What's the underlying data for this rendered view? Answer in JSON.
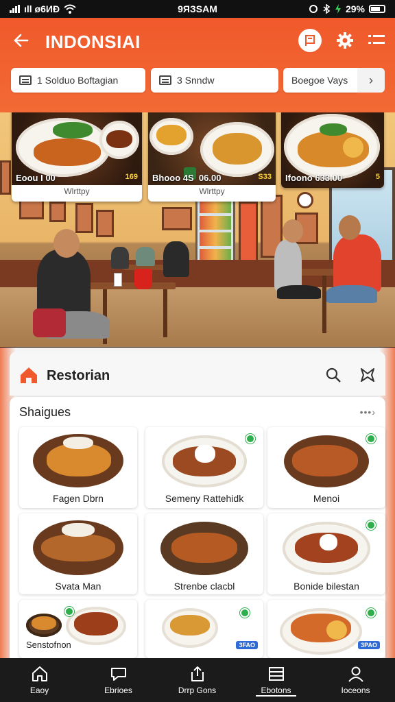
{
  "status_bar": {
    "carrier": "ıll ø6ИÐ",
    "time": "9ЯЗSAM",
    "battery": "29%"
  },
  "header": {
    "title": "INDONSIAI",
    "filters": [
      {
        "label": "1 Solduo Boftagian"
      },
      {
        "label": "3 Snndw"
      },
      {
        "label": "Boegoe Vays"
      }
    ]
  },
  "promos": [
    {
      "price": "Eoou I 00",
      "price2": "169",
      "label": "Wlrttpy"
    },
    {
      "price": "Bhooo 4S  06.00",
      "price2": "S33",
      "label": "Wlrttpy"
    },
    {
      "price": "Ifoono 633.00",
      "price2": "5"
    }
  ],
  "panel": {
    "title": "Restorian",
    "section_title": "Shaigues",
    "more": "•••›"
  },
  "dishes": [
    {
      "name": "Fagen Dbrn"
    },
    {
      "name": "Semeny Rattehidk"
    },
    {
      "name": "Menoi"
    },
    {
      "name": "Svata Man"
    },
    {
      "name": "Strenbe clacbl"
    },
    {
      "name": "Bonide bilestan"
    },
    {
      "name": "Senstofnon"
    },
    {
      "name": ""
    },
    {
      "name": ""
    }
  ],
  "dish_tags": [
    "3FAO",
    "3PAO"
  ],
  "nav": [
    {
      "label": "Eaoy",
      "icon": "home-icon"
    },
    {
      "label": "Ebrioes",
      "icon": "chat-icon"
    },
    {
      "label": "Drrp Gons",
      "icon": "share-icon"
    },
    {
      "label": "Ebotons",
      "icon": "orders-icon"
    },
    {
      "label": "Ioceons",
      "icon": "profile-icon"
    }
  ],
  "colors": {
    "brand_orange": "#f0592b",
    "nav_bg": "#1b1b1b",
    "badge_green": "#2fae4e",
    "tag_blue": "#2f6bd6"
  }
}
